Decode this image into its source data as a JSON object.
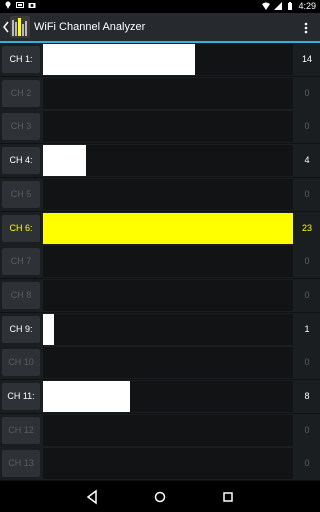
{
  "status_bar": {
    "time": "4:29"
  },
  "app_bar": {
    "title": "WiFi Channel Analyzer"
  },
  "colors": {
    "active_label": "#ffffff",
    "inactive_label": "#5a5e62",
    "bar_default": "#ffffff",
    "bar_highlight": "#ffff00",
    "highlight_text": "#ffff00",
    "accent": "#2fb3d6"
  },
  "max_count": 23,
  "channels": [
    {
      "label": "CH 1:",
      "count": "14",
      "active": true,
      "highlight": false
    },
    {
      "label": "CH 2",
      "count": "0",
      "active": false,
      "highlight": false
    },
    {
      "label": "CH 3",
      "count": "0",
      "active": false,
      "highlight": false
    },
    {
      "label": "CH 4:",
      "count": "4",
      "active": true,
      "highlight": false
    },
    {
      "label": "CH 5",
      "count": "0",
      "active": false,
      "highlight": false
    },
    {
      "label": "CH 6:",
      "count": "23",
      "active": true,
      "highlight": true
    },
    {
      "label": "CH 7",
      "count": "0",
      "active": false,
      "highlight": false
    },
    {
      "label": "CH 8",
      "count": "0",
      "active": false,
      "highlight": false
    },
    {
      "label": "CH 9:",
      "count": "1",
      "active": true,
      "highlight": false
    },
    {
      "label": "CH 10",
      "count": "0",
      "active": false,
      "highlight": false
    },
    {
      "label": "CH 11:",
      "count": "8",
      "active": true,
      "highlight": false
    },
    {
      "label": "CH 12",
      "count": "0",
      "active": false,
      "highlight": false
    },
    {
      "label": "CH 13",
      "count": "0",
      "active": false,
      "highlight": false
    }
  ],
  "nav": {
    "back": "back-icon",
    "home": "home-icon",
    "recents": "recents-icon"
  }
}
